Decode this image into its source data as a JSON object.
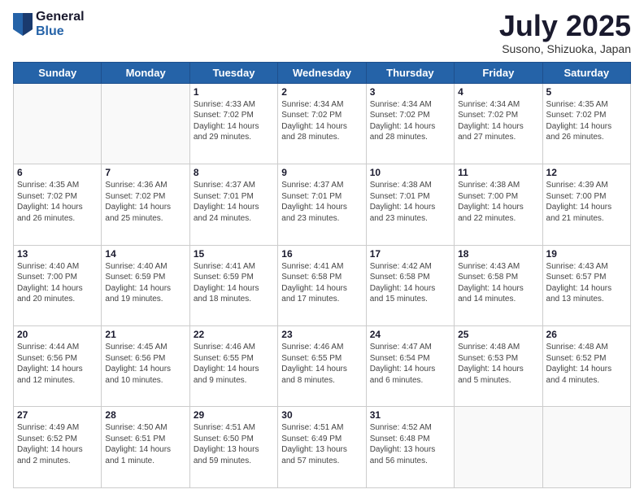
{
  "logo": {
    "general": "General",
    "blue": "Blue"
  },
  "header": {
    "month_year": "July 2025",
    "location": "Susono, Shizuoka, Japan"
  },
  "days_of_week": [
    "Sunday",
    "Monday",
    "Tuesday",
    "Wednesday",
    "Thursday",
    "Friday",
    "Saturday"
  ],
  "weeks": [
    [
      {
        "day": "",
        "info": ""
      },
      {
        "day": "",
        "info": ""
      },
      {
        "day": "1",
        "info": "Sunrise: 4:33 AM\nSunset: 7:02 PM\nDaylight: 14 hours and 29 minutes."
      },
      {
        "day": "2",
        "info": "Sunrise: 4:34 AM\nSunset: 7:02 PM\nDaylight: 14 hours and 28 minutes."
      },
      {
        "day": "3",
        "info": "Sunrise: 4:34 AM\nSunset: 7:02 PM\nDaylight: 14 hours and 28 minutes."
      },
      {
        "day": "4",
        "info": "Sunrise: 4:34 AM\nSunset: 7:02 PM\nDaylight: 14 hours and 27 minutes."
      },
      {
        "day": "5",
        "info": "Sunrise: 4:35 AM\nSunset: 7:02 PM\nDaylight: 14 hours and 26 minutes."
      }
    ],
    [
      {
        "day": "6",
        "info": "Sunrise: 4:35 AM\nSunset: 7:02 PM\nDaylight: 14 hours and 26 minutes."
      },
      {
        "day": "7",
        "info": "Sunrise: 4:36 AM\nSunset: 7:02 PM\nDaylight: 14 hours and 25 minutes."
      },
      {
        "day": "8",
        "info": "Sunrise: 4:37 AM\nSunset: 7:01 PM\nDaylight: 14 hours and 24 minutes."
      },
      {
        "day": "9",
        "info": "Sunrise: 4:37 AM\nSunset: 7:01 PM\nDaylight: 14 hours and 23 minutes."
      },
      {
        "day": "10",
        "info": "Sunrise: 4:38 AM\nSunset: 7:01 PM\nDaylight: 14 hours and 23 minutes."
      },
      {
        "day": "11",
        "info": "Sunrise: 4:38 AM\nSunset: 7:00 PM\nDaylight: 14 hours and 22 minutes."
      },
      {
        "day": "12",
        "info": "Sunrise: 4:39 AM\nSunset: 7:00 PM\nDaylight: 14 hours and 21 minutes."
      }
    ],
    [
      {
        "day": "13",
        "info": "Sunrise: 4:40 AM\nSunset: 7:00 PM\nDaylight: 14 hours and 20 minutes."
      },
      {
        "day": "14",
        "info": "Sunrise: 4:40 AM\nSunset: 6:59 PM\nDaylight: 14 hours and 19 minutes."
      },
      {
        "day": "15",
        "info": "Sunrise: 4:41 AM\nSunset: 6:59 PM\nDaylight: 14 hours and 18 minutes."
      },
      {
        "day": "16",
        "info": "Sunrise: 4:41 AM\nSunset: 6:58 PM\nDaylight: 14 hours and 17 minutes."
      },
      {
        "day": "17",
        "info": "Sunrise: 4:42 AM\nSunset: 6:58 PM\nDaylight: 14 hours and 15 minutes."
      },
      {
        "day": "18",
        "info": "Sunrise: 4:43 AM\nSunset: 6:58 PM\nDaylight: 14 hours and 14 minutes."
      },
      {
        "day": "19",
        "info": "Sunrise: 4:43 AM\nSunset: 6:57 PM\nDaylight: 14 hours and 13 minutes."
      }
    ],
    [
      {
        "day": "20",
        "info": "Sunrise: 4:44 AM\nSunset: 6:56 PM\nDaylight: 14 hours and 12 minutes."
      },
      {
        "day": "21",
        "info": "Sunrise: 4:45 AM\nSunset: 6:56 PM\nDaylight: 14 hours and 10 minutes."
      },
      {
        "day": "22",
        "info": "Sunrise: 4:46 AM\nSunset: 6:55 PM\nDaylight: 14 hours and 9 minutes."
      },
      {
        "day": "23",
        "info": "Sunrise: 4:46 AM\nSunset: 6:55 PM\nDaylight: 14 hours and 8 minutes."
      },
      {
        "day": "24",
        "info": "Sunrise: 4:47 AM\nSunset: 6:54 PM\nDaylight: 14 hours and 6 minutes."
      },
      {
        "day": "25",
        "info": "Sunrise: 4:48 AM\nSunset: 6:53 PM\nDaylight: 14 hours and 5 minutes."
      },
      {
        "day": "26",
        "info": "Sunrise: 4:48 AM\nSunset: 6:52 PM\nDaylight: 14 hours and 4 minutes."
      }
    ],
    [
      {
        "day": "27",
        "info": "Sunrise: 4:49 AM\nSunset: 6:52 PM\nDaylight: 14 hours and 2 minutes."
      },
      {
        "day": "28",
        "info": "Sunrise: 4:50 AM\nSunset: 6:51 PM\nDaylight: 14 hours and 1 minute."
      },
      {
        "day": "29",
        "info": "Sunrise: 4:51 AM\nSunset: 6:50 PM\nDaylight: 13 hours and 59 minutes."
      },
      {
        "day": "30",
        "info": "Sunrise: 4:51 AM\nSunset: 6:49 PM\nDaylight: 13 hours and 57 minutes."
      },
      {
        "day": "31",
        "info": "Sunrise: 4:52 AM\nSunset: 6:48 PM\nDaylight: 13 hours and 56 minutes."
      },
      {
        "day": "",
        "info": ""
      },
      {
        "day": "",
        "info": ""
      }
    ]
  ]
}
